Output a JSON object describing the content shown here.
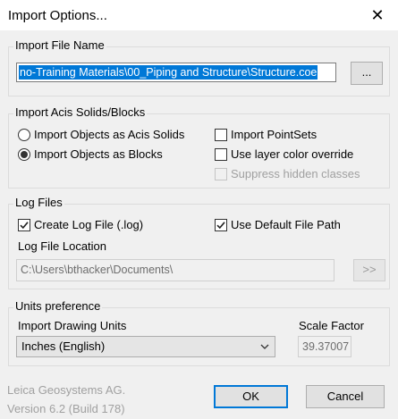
{
  "window": {
    "title": "Import Options...",
    "close_glyph": "✕"
  },
  "import_file": {
    "group_label": "Import File Name",
    "path_value": "no-Training Materials\\00_Piping and Structure\\Structure.coe",
    "browse_label": "..."
  },
  "acis": {
    "group_label": "Import Acis Solids/Blocks",
    "radio_solids": "Import Objects as Acis Solids",
    "radio_blocks": "Import Objects as Blocks",
    "selected": "blocks",
    "check_pointsets": "Import PointSets",
    "check_layer_color": "Use layer color override",
    "check_suppress": "Suppress hidden classes"
  },
  "log_files": {
    "group_label": "Log Files",
    "check_create_log": "Create Log File (.log)",
    "check_default_path": "Use Default File Path",
    "location_label": "Log File Location",
    "location_value": "C:\\Users\\bthacker\\Documents\\",
    "browse_label": ">>"
  },
  "units": {
    "group_label": "Units preference",
    "drawing_units_label": "Import Drawing Units",
    "drawing_units_value": "Inches (English)",
    "scale_label": "Scale Factor",
    "scale_value": "39.37007"
  },
  "footer": {
    "company": "Leica Geosystems AG.",
    "version": "Version 6.2 (Build 178)",
    "ok_label": "OK",
    "cancel_label": "Cancel"
  },
  "colors": {
    "accent": "#0078d7",
    "background": "#f0f0f0",
    "disabled_text": "#a0a0a0"
  }
}
